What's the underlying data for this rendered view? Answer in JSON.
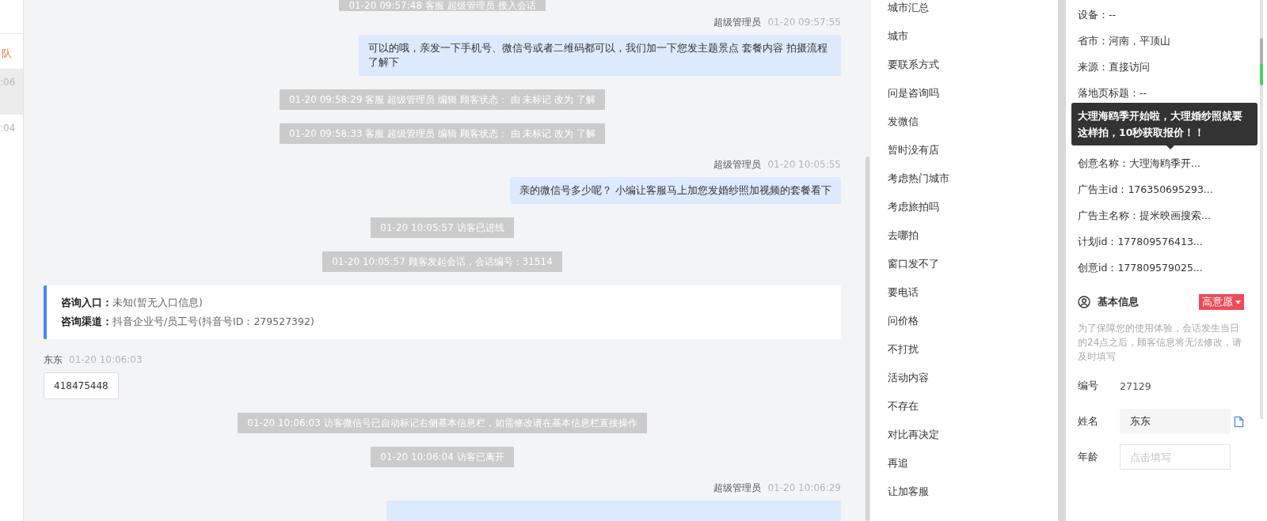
{
  "sidebar": {
    "tab_label": "队",
    "items": [
      {
        "time": ":06",
        "selected": true
      },
      {
        "time": ":04",
        "selected": false
      }
    ]
  },
  "messages": [
    {
      "kind": "system",
      "text": "01-20 09:57:48 客服 超级管理员 接入会话"
    },
    {
      "kind": "agent",
      "sender": "超级管理员",
      "time": "01-20 09:57:55",
      "text": "可以的哦，亲发一下手机号、微信号或者二维码都可以，我们加一下您发主题景点 套餐内容 拍摄流程了解下"
    },
    {
      "kind": "system",
      "text": "01-20 09:58:29 客服 超级管理员 编辑 顾客状态： 由 未标记 改为 了解"
    },
    {
      "kind": "system",
      "text": "01-20 09:58:33 客服 超级管理员 编辑 顾客状态： 由 未标记 改为 了解"
    },
    {
      "kind": "agent",
      "sender": "超级管理员",
      "time": "01-20 10:05:55",
      "text": "亲的微信号多少呢？ 小编让客服马上加您发婚纱照加视频的套餐看下"
    },
    {
      "kind": "system",
      "text": "01-20 10:05:57 访客已进线"
    },
    {
      "kind": "system",
      "text": "01-20 10:05:57 顾客发起会话，会话编号：31514"
    },
    {
      "kind": "entry_info",
      "rows": [
        {
          "label": "咨询入口：",
          "value": "未知(暂无入口信息)"
        },
        {
          "label": "咨询渠道：",
          "value": "抖音企业号/员工号(抖音号ID：279527392)"
        }
      ]
    },
    {
      "kind": "visitor",
      "sender": "东东",
      "time": "01-20 10:06:03",
      "text": "418475448"
    },
    {
      "kind": "system",
      "text": "01-20 10:06:03 访客微信号已自动标记右侧基本信息栏，如需修改请在基本信息栏直接操作"
    },
    {
      "kind": "system",
      "text": "01-20 10:06:04 访客已离开"
    },
    {
      "kind": "agent",
      "sender": "超级管理员",
      "time": "01-20 10:06:29"
    }
  ],
  "quick_replies": [
    "城市汇总",
    "城市",
    "要联系方式",
    "问是咨询吗",
    "发微信",
    "暂时没有店",
    "考虑热门城市",
    "考虑旅拍吗",
    "去哪拍",
    "窗口发不了",
    "要电话",
    "问价格",
    "不打扰",
    "活动内容",
    "不存在",
    "对比再决定",
    "再追",
    "让加客服"
  ],
  "visitor_info": {
    "rows_before": [
      "设备：--",
      "省市：河南，平顶山",
      "来源：直接访问",
      "落地页标题：--"
    ],
    "tooltip": "大理海鸥季开始啦，大理婚纱照就要这样拍，10秒获取报价！！",
    "rows_after": [
      "创意名称：大理海鸥季开...",
      "广告主id：176350695293...",
      "广告主名称：提米映画搜索...",
      "计划id：177809576413...",
      "创意id：177809579025..."
    ]
  },
  "basic_info": {
    "title": "基本信息",
    "intent_badge": "高意愿",
    "note": "为了保障您的使用体验，会话发生当日的24点之后，顾客信息将无法修改，请及时填写",
    "fields": [
      {
        "kind": "text",
        "label": "编号",
        "value": "27129"
      },
      {
        "kind": "input",
        "label": "姓名",
        "value": "东东",
        "copyable": true
      },
      {
        "kind": "input",
        "label": "年龄",
        "placeholder": "点击填写",
        "copyable": false
      }
    ]
  }
}
